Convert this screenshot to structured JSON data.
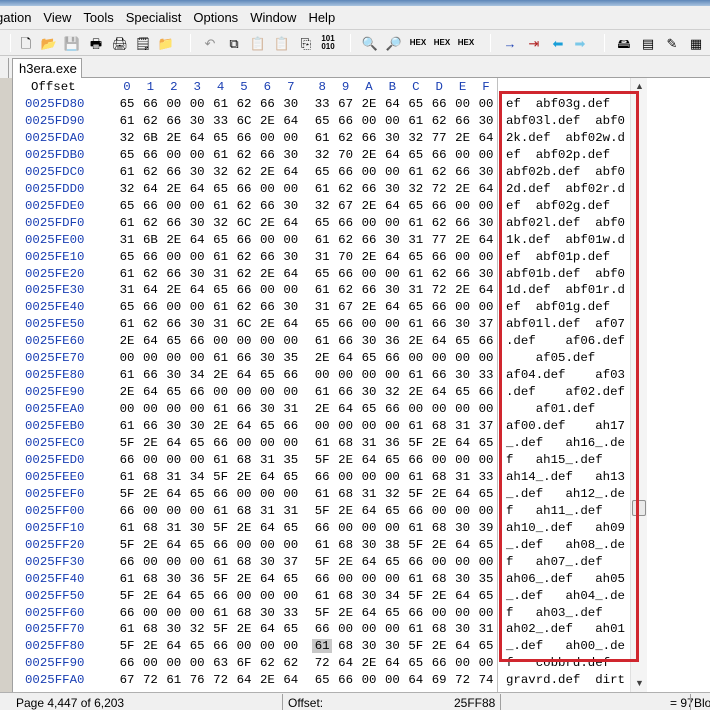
{
  "menu": [
    "gation",
    "View",
    "Tools",
    "Specialist",
    "Options",
    "Window",
    "Help"
  ],
  "toolbar": {
    "new": "🗋",
    "open": "📂",
    "save": "💾",
    "print": "🖶",
    "print2": "🖨",
    "properties": "🗒",
    "open_disk": "📁",
    "undo": "↶",
    "copy": "⧉",
    "paste": "📋",
    "paste2": "📋",
    "copy_block": "⎘",
    "binary_label": "101\n010",
    "find": "🔍",
    "find_next": "🔎",
    "find_hex": "HEX",
    "replace_hex": "HEX",
    "goto": "→",
    "goto_offset": "⇥",
    "back": "⬅",
    "forward": "➡",
    "disk": "🖴",
    "ram": "▤",
    "tools": "✎",
    "calc": "▦"
  },
  "tab": {
    "title": "h3era.exe"
  },
  "editor": {
    "offset_header": "Offset",
    "columns": [
      "0",
      "1",
      "2",
      "3",
      "4",
      "5",
      "6",
      "7",
      "8",
      "9",
      "A",
      "B",
      "C",
      "D",
      "E",
      "F"
    ],
    "rows": [
      {
        "offset": "0025FD80",
        "hex": [
          "65",
          "66",
          "00",
          "00",
          "61",
          "62",
          "66",
          "30",
          "33",
          "67",
          "2E",
          "64",
          "65",
          "66",
          "00",
          "00"
        ],
        "ascii": "ef  abf03g.def  "
      },
      {
        "offset": "0025FD90",
        "hex": [
          "61",
          "62",
          "66",
          "30",
          "33",
          "6C",
          "2E",
          "64",
          "65",
          "66",
          "00",
          "00",
          "61",
          "62",
          "66",
          "30"
        ],
        "ascii": "abf03l.def  abf0"
      },
      {
        "offset": "0025FDA0",
        "hex": [
          "32",
          "6B",
          "2E",
          "64",
          "65",
          "66",
          "00",
          "00",
          "61",
          "62",
          "66",
          "30",
          "32",
          "77",
          "2E",
          "64"
        ],
        "ascii": "2k.def  abf02w.d"
      },
      {
        "offset": "0025FDB0",
        "hex": [
          "65",
          "66",
          "00",
          "00",
          "61",
          "62",
          "66",
          "30",
          "32",
          "70",
          "2E",
          "64",
          "65",
          "66",
          "00",
          "00"
        ],
        "ascii": "ef  abf02p.def  "
      },
      {
        "offset": "0025FDC0",
        "hex": [
          "61",
          "62",
          "66",
          "30",
          "32",
          "62",
          "2E",
          "64",
          "65",
          "66",
          "00",
          "00",
          "61",
          "62",
          "66",
          "30"
        ],
        "ascii": "abf02b.def  abf0"
      },
      {
        "offset": "0025FDD0",
        "hex": [
          "32",
          "64",
          "2E",
          "64",
          "65",
          "66",
          "00",
          "00",
          "61",
          "62",
          "66",
          "30",
          "32",
          "72",
          "2E",
          "64"
        ],
        "ascii": "2d.def  abf02r.d"
      },
      {
        "offset": "0025FDE0",
        "hex": [
          "65",
          "66",
          "00",
          "00",
          "61",
          "62",
          "66",
          "30",
          "32",
          "67",
          "2E",
          "64",
          "65",
          "66",
          "00",
          "00"
        ],
        "ascii": "ef  abf02g.def  "
      },
      {
        "offset": "0025FDF0",
        "hex": [
          "61",
          "62",
          "66",
          "30",
          "32",
          "6C",
          "2E",
          "64",
          "65",
          "66",
          "00",
          "00",
          "61",
          "62",
          "66",
          "30"
        ],
        "ascii": "abf02l.def  abf0"
      },
      {
        "offset": "0025FE00",
        "hex": [
          "31",
          "6B",
          "2E",
          "64",
          "65",
          "66",
          "00",
          "00",
          "61",
          "62",
          "66",
          "30",
          "31",
          "77",
          "2E",
          "64"
        ],
        "ascii": "1k.def  abf01w.d"
      },
      {
        "offset": "0025FE10",
        "hex": [
          "65",
          "66",
          "00",
          "00",
          "61",
          "62",
          "66",
          "30",
          "31",
          "70",
          "2E",
          "64",
          "65",
          "66",
          "00",
          "00"
        ],
        "ascii": "ef  abf01p.def  "
      },
      {
        "offset": "0025FE20",
        "hex": [
          "61",
          "62",
          "66",
          "30",
          "31",
          "62",
          "2E",
          "64",
          "65",
          "66",
          "00",
          "00",
          "61",
          "62",
          "66",
          "30"
        ],
        "ascii": "abf01b.def  abf0"
      },
      {
        "offset": "0025FE30",
        "hex": [
          "31",
          "64",
          "2E",
          "64",
          "65",
          "66",
          "00",
          "00",
          "61",
          "62",
          "66",
          "30",
          "31",
          "72",
          "2E",
          "64"
        ],
        "ascii": "1d.def  abf01r.d"
      },
      {
        "offset": "0025FE40",
        "hex": [
          "65",
          "66",
          "00",
          "00",
          "61",
          "62",
          "66",
          "30",
          "31",
          "67",
          "2E",
          "64",
          "65",
          "66",
          "00",
          "00"
        ],
        "ascii": "ef  abf01g.def  "
      },
      {
        "offset": "0025FE50",
        "hex": [
          "61",
          "62",
          "66",
          "30",
          "31",
          "6C",
          "2E",
          "64",
          "65",
          "66",
          "00",
          "00",
          "61",
          "66",
          "30",
          "37"
        ],
        "ascii": "abf01l.def  af07"
      },
      {
        "offset": "0025FE60",
        "hex": [
          "2E",
          "64",
          "65",
          "66",
          "00",
          "00",
          "00",
          "00",
          "61",
          "66",
          "30",
          "36",
          "2E",
          "64",
          "65",
          "66"
        ],
        "ascii": ".def    af06.def"
      },
      {
        "offset": "0025FE70",
        "hex": [
          "00",
          "00",
          "00",
          "00",
          "61",
          "66",
          "30",
          "35",
          "2E",
          "64",
          "65",
          "66",
          "00",
          "00",
          "00",
          "00"
        ],
        "ascii": "    af05.def    "
      },
      {
        "offset": "0025FE80",
        "hex": [
          "61",
          "66",
          "30",
          "34",
          "2E",
          "64",
          "65",
          "66",
          "00",
          "00",
          "00",
          "00",
          "61",
          "66",
          "30",
          "33"
        ],
        "ascii": "af04.def    af03"
      },
      {
        "offset": "0025FE90",
        "hex": [
          "2E",
          "64",
          "65",
          "66",
          "00",
          "00",
          "00",
          "00",
          "61",
          "66",
          "30",
          "32",
          "2E",
          "64",
          "65",
          "66"
        ],
        "ascii": ".def    af02.def"
      },
      {
        "offset": "0025FEA0",
        "hex": [
          "00",
          "00",
          "00",
          "00",
          "61",
          "66",
          "30",
          "31",
          "2E",
          "64",
          "65",
          "66",
          "00",
          "00",
          "00",
          "00"
        ],
        "ascii": "    af01.def    "
      },
      {
        "offset": "0025FEB0",
        "hex": [
          "61",
          "66",
          "30",
          "30",
          "2E",
          "64",
          "65",
          "66",
          "00",
          "00",
          "00",
          "00",
          "61",
          "68",
          "31",
          "37"
        ],
        "ascii": "af00.def    ah17"
      },
      {
        "offset": "0025FEC0",
        "hex": [
          "5F",
          "2E",
          "64",
          "65",
          "66",
          "00",
          "00",
          "00",
          "61",
          "68",
          "31",
          "36",
          "5F",
          "2E",
          "64",
          "65"
        ],
        "ascii": "_.def   ah16_.de"
      },
      {
        "offset": "0025FED0",
        "hex": [
          "66",
          "00",
          "00",
          "00",
          "61",
          "68",
          "31",
          "35",
          "5F",
          "2E",
          "64",
          "65",
          "66",
          "00",
          "00",
          "00"
        ],
        "ascii": "f   ah15_.def   "
      },
      {
        "offset": "0025FEE0",
        "hex": [
          "61",
          "68",
          "31",
          "34",
          "5F",
          "2E",
          "64",
          "65",
          "66",
          "00",
          "00",
          "00",
          "61",
          "68",
          "31",
          "33"
        ],
        "ascii": "ah14_.def   ah13"
      },
      {
        "offset": "0025FEF0",
        "hex": [
          "5F",
          "2E",
          "64",
          "65",
          "66",
          "00",
          "00",
          "00",
          "61",
          "68",
          "31",
          "32",
          "5F",
          "2E",
          "64",
          "65"
        ],
        "ascii": "_.def   ah12_.de"
      },
      {
        "offset": "0025FF00",
        "hex": [
          "66",
          "00",
          "00",
          "00",
          "61",
          "68",
          "31",
          "31",
          "5F",
          "2E",
          "64",
          "65",
          "66",
          "00",
          "00",
          "00"
        ],
        "ascii": "f   ah11_.def   "
      },
      {
        "offset": "0025FF10",
        "hex": [
          "61",
          "68",
          "31",
          "30",
          "5F",
          "2E",
          "64",
          "65",
          "66",
          "00",
          "00",
          "00",
          "61",
          "68",
          "30",
          "39"
        ],
        "ascii": "ah10_.def   ah09"
      },
      {
        "offset": "0025FF20",
        "hex": [
          "5F",
          "2E",
          "64",
          "65",
          "66",
          "00",
          "00",
          "00",
          "61",
          "68",
          "30",
          "38",
          "5F",
          "2E",
          "64",
          "65"
        ],
        "ascii": "_.def   ah08_.de"
      },
      {
        "offset": "0025FF30",
        "hex": [
          "66",
          "00",
          "00",
          "00",
          "61",
          "68",
          "30",
          "37",
          "5F",
          "2E",
          "64",
          "65",
          "66",
          "00",
          "00",
          "00"
        ],
        "ascii": "f   ah07_.def   "
      },
      {
        "offset": "0025FF40",
        "hex": [
          "61",
          "68",
          "30",
          "36",
          "5F",
          "2E",
          "64",
          "65",
          "66",
          "00",
          "00",
          "00",
          "61",
          "68",
          "30",
          "35"
        ],
        "ascii": "ah06_.def   ah05"
      },
      {
        "offset": "0025FF50",
        "hex": [
          "5F",
          "2E",
          "64",
          "65",
          "66",
          "00",
          "00",
          "00",
          "61",
          "68",
          "30",
          "34",
          "5F",
          "2E",
          "64",
          "65"
        ],
        "ascii": "_.def   ah04_.de"
      },
      {
        "offset": "0025FF60",
        "hex": [
          "66",
          "00",
          "00",
          "00",
          "61",
          "68",
          "30",
          "33",
          "5F",
          "2E",
          "64",
          "65",
          "66",
          "00",
          "00",
          "00"
        ],
        "ascii": "f   ah03_.def   "
      },
      {
        "offset": "0025FF70",
        "hex": [
          "61",
          "68",
          "30",
          "32",
          "5F",
          "2E",
          "64",
          "65",
          "66",
          "00",
          "00",
          "00",
          "61",
          "68",
          "30",
          "31"
        ],
        "ascii": "ah02_.def   ah01"
      },
      {
        "offset": "0025FF80",
        "hex": [
          "5F",
          "2E",
          "64",
          "65",
          "66",
          "00",
          "00",
          "00",
          "61",
          "68",
          "30",
          "30",
          "5F",
          "2E",
          "64",
          "65"
        ],
        "ascii": "_.def   ah00_.de",
        "cursor_col": 8
      },
      {
        "offset": "0025FF90",
        "hex": [
          "66",
          "00",
          "00",
          "00",
          "63",
          "6F",
          "62",
          "62",
          "72",
          "64",
          "2E",
          "64",
          "65",
          "66",
          "00",
          "00"
        ],
        "ascii": "f   cobbrd.def  "
      },
      {
        "offset": "0025FFA0",
        "hex": [
          "67",
          "72",
          "61",
          "76",
          "72",
          "64",
          "2E",
          "64",
          "65",
          "66",
          "00",
          "00",
          "64",
          "69",
          "72",
          "74"
        ],
        "ascii": "gravrd.def  dirt"
      }
    ]
  },
  "status": {
    "page": "Page 4,447 of 6,203",
    "offset_label": "Offset:",
    "offset_value": "25FF88",
    "value": "= 97",
    "block": "Blo"
  },
  "colors": {
    "offset_blue": "#1a3fb3",
    "highlight_red": "#d0262e"
  }
}
